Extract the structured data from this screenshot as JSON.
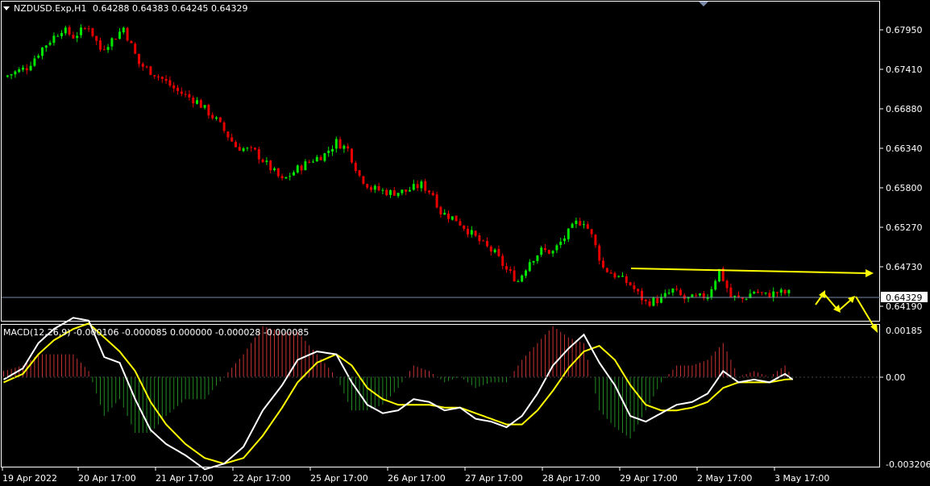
{
  "header": {
    "symbol": "NZDUSD.Exp,H1",
    "ohlc": "0.64288 0.64383 0.64245 0.64329"
  },
  "macd": {
    "label": "MACD(12,26,9) -0.000106 -0.000085 0.000000 -0.000028 -0.000085"
  },
  "price_axis": {
    "ticks": [
      "0.67950",
      "0.67410",
      "0.66880",
      "0.66340",
      "0.65800",
      "0.65270",
      "0.64730",
      "0.64190"
    ],
    "current": "0.64329"
  },
  "macd_axis": {
    "ticks": [
      "0.00185",
      "0.00",
      "-0.003206"
    ]
  },
  "time_axis": {
    "labels": [
      "19 Apr 2022",
      "20 Apr 17:00",
      "21 Apr 17:00",
      "22 Apr 17:00",
      "25 Apr 17:00",
      "26 Apr 17:00",
      "27 Apr 17:00",
      "28 Apr 17:00",
      "29 Apr 17:00",
      "2 May 17:00",
      "3 May 17:00"
    ]
  },
  "colors": {
    "background": "#000000",
    "bull": "#00e600",
    "bear": "#e60000",
    "annotation": "#ffff00",
    "macd_line": "#ffffff",
    "signal_line": "#ffff00",
    "hist_pos": "#c83232",
    "hist_neg": "#228b22",
    "grid": "#ffffff",
    "current_line": "#7a8aa8"
  },
  "chart_data": [
    {
      "type": "candlestick",
      "title": "NZDUSD.Exp,H1",
      "timeframe": "H1",
      "last": 0.64329,
      "ylim": [
        0.6395,
        0.6836
      ],
      "close_path": [
        [
          0,
          0.6732
        ],
        [
          6,
          0.6745
        ],
        [
          10,
          0.6772
        ],
        [
          15,
          0.6798
        ],
        [
          18,
          0.6788
        ],
        [
          22,
          0.6802
        ],
        [
          25,
          0.677
        ],
        [
          29,
          0.6788
        ],
        [
          31,
          0.68
        ],
        [
          35,
          0.675
        ],
        [
          40,
          0.6733
        ],
        [
          45,
          0.6712
        ],
        [
          50,
          0.6698
        ],
        [
          55,
          0.6672
        ],
        [
          60,
          0.6636
        ],
        [
          65,
          0.6628
        ],
        [
          70,
          0.66
        ],
        [
          72,
          0.6588
        ],
        [
          76,
          0.6605
        ],
        [
          80,
          0.6618
        ],
        [
          83,
          0.6625
        ],
        [
          86,
          0.6642
        ],
        [
          89,
          0.6632
        ],
        [
          92,
          0.6595
        ],
        [
          95,
          0.6578
        ],
        [
          100,
          0.6572
        ],
        [
          104,
          0.6574
        ],
        [
          108,
          0.6583
        ],
        [
          111,
          0.657
        ],
        [
          113,
          0.6545
        ],
        [
          117,
          0.6535
        ],
        [
          121,
          0.6515
        ],
        [
          124,
          0.65
        ],
        [
          127,
          0.6488
        ],
        [
          130,
          0.6465
        ],
        [
          133,
          0.645
        ],
        [
          136,
          0.6478
        ],
        [
          139,
          0.6492
        ],
        [
          142,
          0.649
        ],
        [
          145,
          0.651
        ],
        [
          148,
          0.653
        ],
        [
          150,
          0.6533
        ],
        [
          152,
          0.6512
        ],
        [
          155,
          0.6468
        ],
        [
          158,
          0.6458
        ],
        [
          162,
          0.6445
        ],
        [
          164,
          0.6432
        ],
        [
          166,
          0.642
        ],
        [
          170,
          0.6425
        ],
        [
          173,
          0.6437
        ],
        [
          176,
          0.6425
        ],
        [
          179,
          0.6426
        ],
        [
          182,
          0.643
        ],
        [
          185,
          0.6465
        ],
        [
          188,
          0.6428
        ],
        [
          191,
          0.6425
        ],
        [
          194,
          0.6436
        ],
        [
          197,
          0.643
        ],
        [
          200,
          0.6434
        ],
        [
          203,
          0.6433
        ]
      ]
    },
    {
      "type": "line",
      "title": "MACD(12,26,9)",
      "values": [
        -0.000106,
        -8.5e-05,
        0.0,
        -2.8e-05,
        -8.5e-05
      ],
      "ylim": [
        -0.003206,
        0.00185
      ],
      "series": [
        {
          "name": "MACD",
          "points": [
            [
              0,
              -0.0001
            ],
            [
              5,
              0.0003
            ],
            [
              9,
              0.0012
            ],
            [
              13,
              0.0017
            ],
            [
              18,
              0.0021
            ],
            [
              22,
              0.002
            ],
            [
              26,
              0.0007
            ],
            [
              30,
              0.0005
            ],
            [
              34,
              -0.0008
            ],
            [
              38,
              -0.0019
            ],
            [
              42,
              -0.0024
            ],
            [
              47,
              -0.0028
            ],
            [
              52,
              -0.0033
            ],
            [
              57,
              -0.0031
            ],
            [
              62,
              -0.0025
            ],
            [
              67,
              -0.0012
            ],
            [
              72,
              -0.0003
            ],
            [
              76,
              0.0006
            ],
            [
              81,
              0.0009
            ],
            [
              86,
              0.0008
            ],
            [
              90,
              -0.0002
            ],
            [
              94,
              -0.001
            ],
            [
              98,
              -0.0013
            ],
            [
              102,
              -0.0012
            ],
            [
              106,
              -0.0008
            ],
            [
              110,
              -0.0009
            ],
            [
              114,
              -0.0012
            ],
            [
              118,
              -0.0011
            ],
            [
              122,
              -0.0015
            ],
            [
              126,
              -0.0016
            ],
            [
              130,
              -0.0018
            ],
            [
              134,
              -0.0014
            ],
            [
              138,
              -0.0006
            ],
            [
              142,
              0.0004
            ],
            [
              146,
              0.001
            ],
            [
              150,
              0.0015
            ],
            [
              154,
              0.0005
            ],
            [
              158,
              -0.0003
            ],
            [
              162,
              -0.0014
            ],
            [
              166,
              -0.0016
            ],
            [
              170,
              -0.0013
            ],
            [
              174,
              -0.001
            ],
            [
              178,
              -0.0009
            ],
            [
              182,
              -0.0006
            ],
            [
              186,
              0.0002
            ],
            [
              190,
              -0.0002
            ],
            [
              194,
              -0.0001
            ],
            [
              198,
              -0.0002
            ],
            [
              202,
              0.0001
            ],
            [
              204,
              -0.000106
            ]
          ]
        },
        {
          "name": "Signal",
          "points": [
            [
              0,
              -0.0002
            ],
            [
              5,
              0.0001
            ],
            [
              9,
              0.0008
            ],
            [
              13,
              0.0013
            ],
            [
              18,
              0.0017
            ],
            [
              22,
              0.0019
            ],
            [
              26,
              0.0014
            ],
            [
              30,
              0.0009
            ],
            [
              34,
              0.0002
            ],
            [
              38,
              -0.0009
            ],
            [
              42,
              -0.0017
            ],
            [
              47,
              -0.0024
            ],
            [
              52,
              -0.0029
            ],
            [
              57,
              -0.0031
            ],
            [
              62,
              -0.0029
            ],
            [
              67,
              -0.0021
            ],
            [
              72,
              -0.0011
            ],
            [
              76,
              -0.0002
            ],
            [
              81,
              0.0005
            ],
            [
              86,
              0.0008
            ],
            [
              90,
              0.0004
            ],
            [
              94,
              -0.0004
            ],
            [
              98,
              -0.0008
            ],
            [
              102,
              -0.001
            ],
            [
              106,
              -0.001
            ],
            [
              110,
              -0.001
            ],
            [
              114,
              -0.0011
            ],
            [
              118,
              -0.0011
            ],
            [
              122,
              -0.0013
            ],
            [
              126,
              -0.0015
            ],
            [
              130,
              -0.0017
            ],
            [
              134,
              -0.0017
            ],
            [
              138,
              -0.0012
            ],
            [
              142,
              -0.0005
            ],
            [
              146,
              0.0003
            ],
            [
              150,
              0.0009
            ],
            [
              154,
              0.0011
            ],
            [
              158,
              0.0006
            ],
            [
              162,
              -0.0003
            ],
            [
              166,
              -0.001
            ],
            [
              170,
              -0.0012
            ],
            [
              174,
              -0.0012
            ],
            [
              178,
              -0.0011
            ],
            [
              182,
              -0.0009
            ],
            [
              186,
              -0.0004
            ],
            [
              190,
              -0.0002
            ],
            [
              194,
              -0.0002
            ],
            [
              198,
              -0.0002
            ],
            [
              202,
              -0.0001
            ],
            [
              204,
              -8.5e-05
            ]
          ]
        }
      ]
    }
  ]
}
